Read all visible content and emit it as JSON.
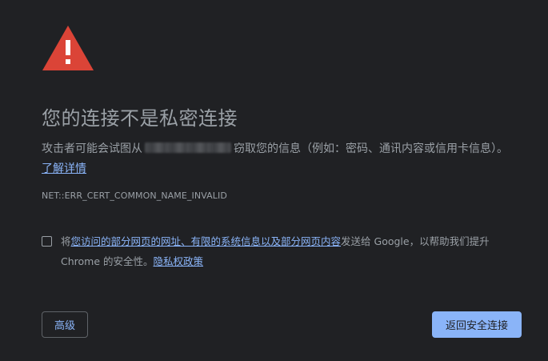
{
  "interstitial": {
    "title": "您的连接不是私密连接",
    "description_before": "攻击者可能会试图从",
    "description_after": "窃取您的信息（例如：密码、通讯内容或信用卡信息）。",
    "learn_more_link": "了解详情",
    "error_code": "NET::ERR_CERT_COMMON_NAME_INVALID"
  },
  "optin": {
    "checked": false,
    "prefix": "将",
    "link_text": "您访问的部分网页的网址、有限的系统信息以及部分网页内容",
    "middle": "发送给 Google，以帮助我们提升 Chrome 的安全性。",
    "privacy_link": "隐私权政策"
  },
  "buttons": {
    "advanced_label": "高级",
    "back_to_safety_label": "返回安全连接"
  },
  "icons": {
    "warning": "warning-triangle-icon"
  },
  "colors": {
    "background": "#202124",
    "text": "#9aa0a6",
    "link": "#8ab4f8",
    "warning_red": "#db4437",
    "primary_button": "#8ab4f8"
  }
}
